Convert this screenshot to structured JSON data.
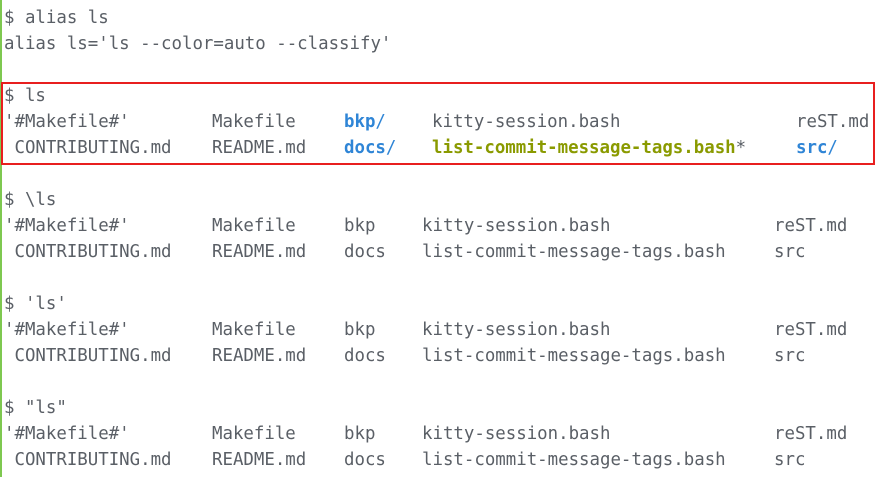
{
  "block1": {
    "prompt": "$ alias ls",
    "output": "alias ls='ls --color=auto --classify'"
  },
  "block2": {
    "prompt": "$ ls",
    "row1": {
      "c1": "'#Makefile#'",
      "c2": "Makefile",
      "c3_name": "bkp",
      "c3_suffix": "/",
      "c4": "kitty-session.bash",
      "c5": "reST.md"
    },
    "row2": {
      "c1": " CONTRIBUTING.md",
      "c2": "README.md",
      "c3_name": "docs",
      "c3_suffix": "/",
      "c4_name": "list-commit-message-tags.bash",
      "c4_suffix": "*",
      "c5_name": "src",
      "c5_suffix": "/"
    }
  },
  "block3": {
    "prompt": "$ \\ls",
    "row1": {
      "c1": "'#Makefile#'",
      "c2": "Makefile",
      "c3": "bkp",
      "c4": "kitty-session.bash",
      "c5": "reST.md"
    },
    "row2": {
      "c1": " CONTRIBUTING.md",
      "c2": "README.md",
      "c3": "docs",
      "c4": "list-commit-message-tags.bash",
      "c5": "src"
    }
  },
  "block4": {
    "prompt": "$ 'ls'",
    "row1": {
      "c1": "'#Makefile#'",
      "c2": "Makefile",
      "c3": "bkp",
      "c4": "kitty-session.bash",
      "c5": "reST.md"
    },
    "row2": {
      "c1": " CONTRIBUTING.md",
      "c2": "README.md",
      "c3": "docs",
      "c4": "list-commit-message-tags.bash",
      "c5": "src"
    }
  },
  "block5": {
    "prompt": "$ \"ls\"",
    "row1": {
      "c1": "'#Makefile#'",
      "c2": "Makefile",
      "c3": "bkp",
      "c4": "kitty-session.bash",
      "c5": "reST.md"
    },
    "row2": {
      "c1": " CONTRIBUTING.md",
      "c2": "README.md",
      "c3": "docs",
      "c4": "list-commit-message-tags.bash",
      "c5": "src"
    }
  },
  "colors": {
    "text": "#5a5f66",
    "directory": "#2f85d6",
    "executable": "#8a9a00",
    "highlight_box": "#e81f1f",
    "left_rule": "#7ec850"
  }
}
